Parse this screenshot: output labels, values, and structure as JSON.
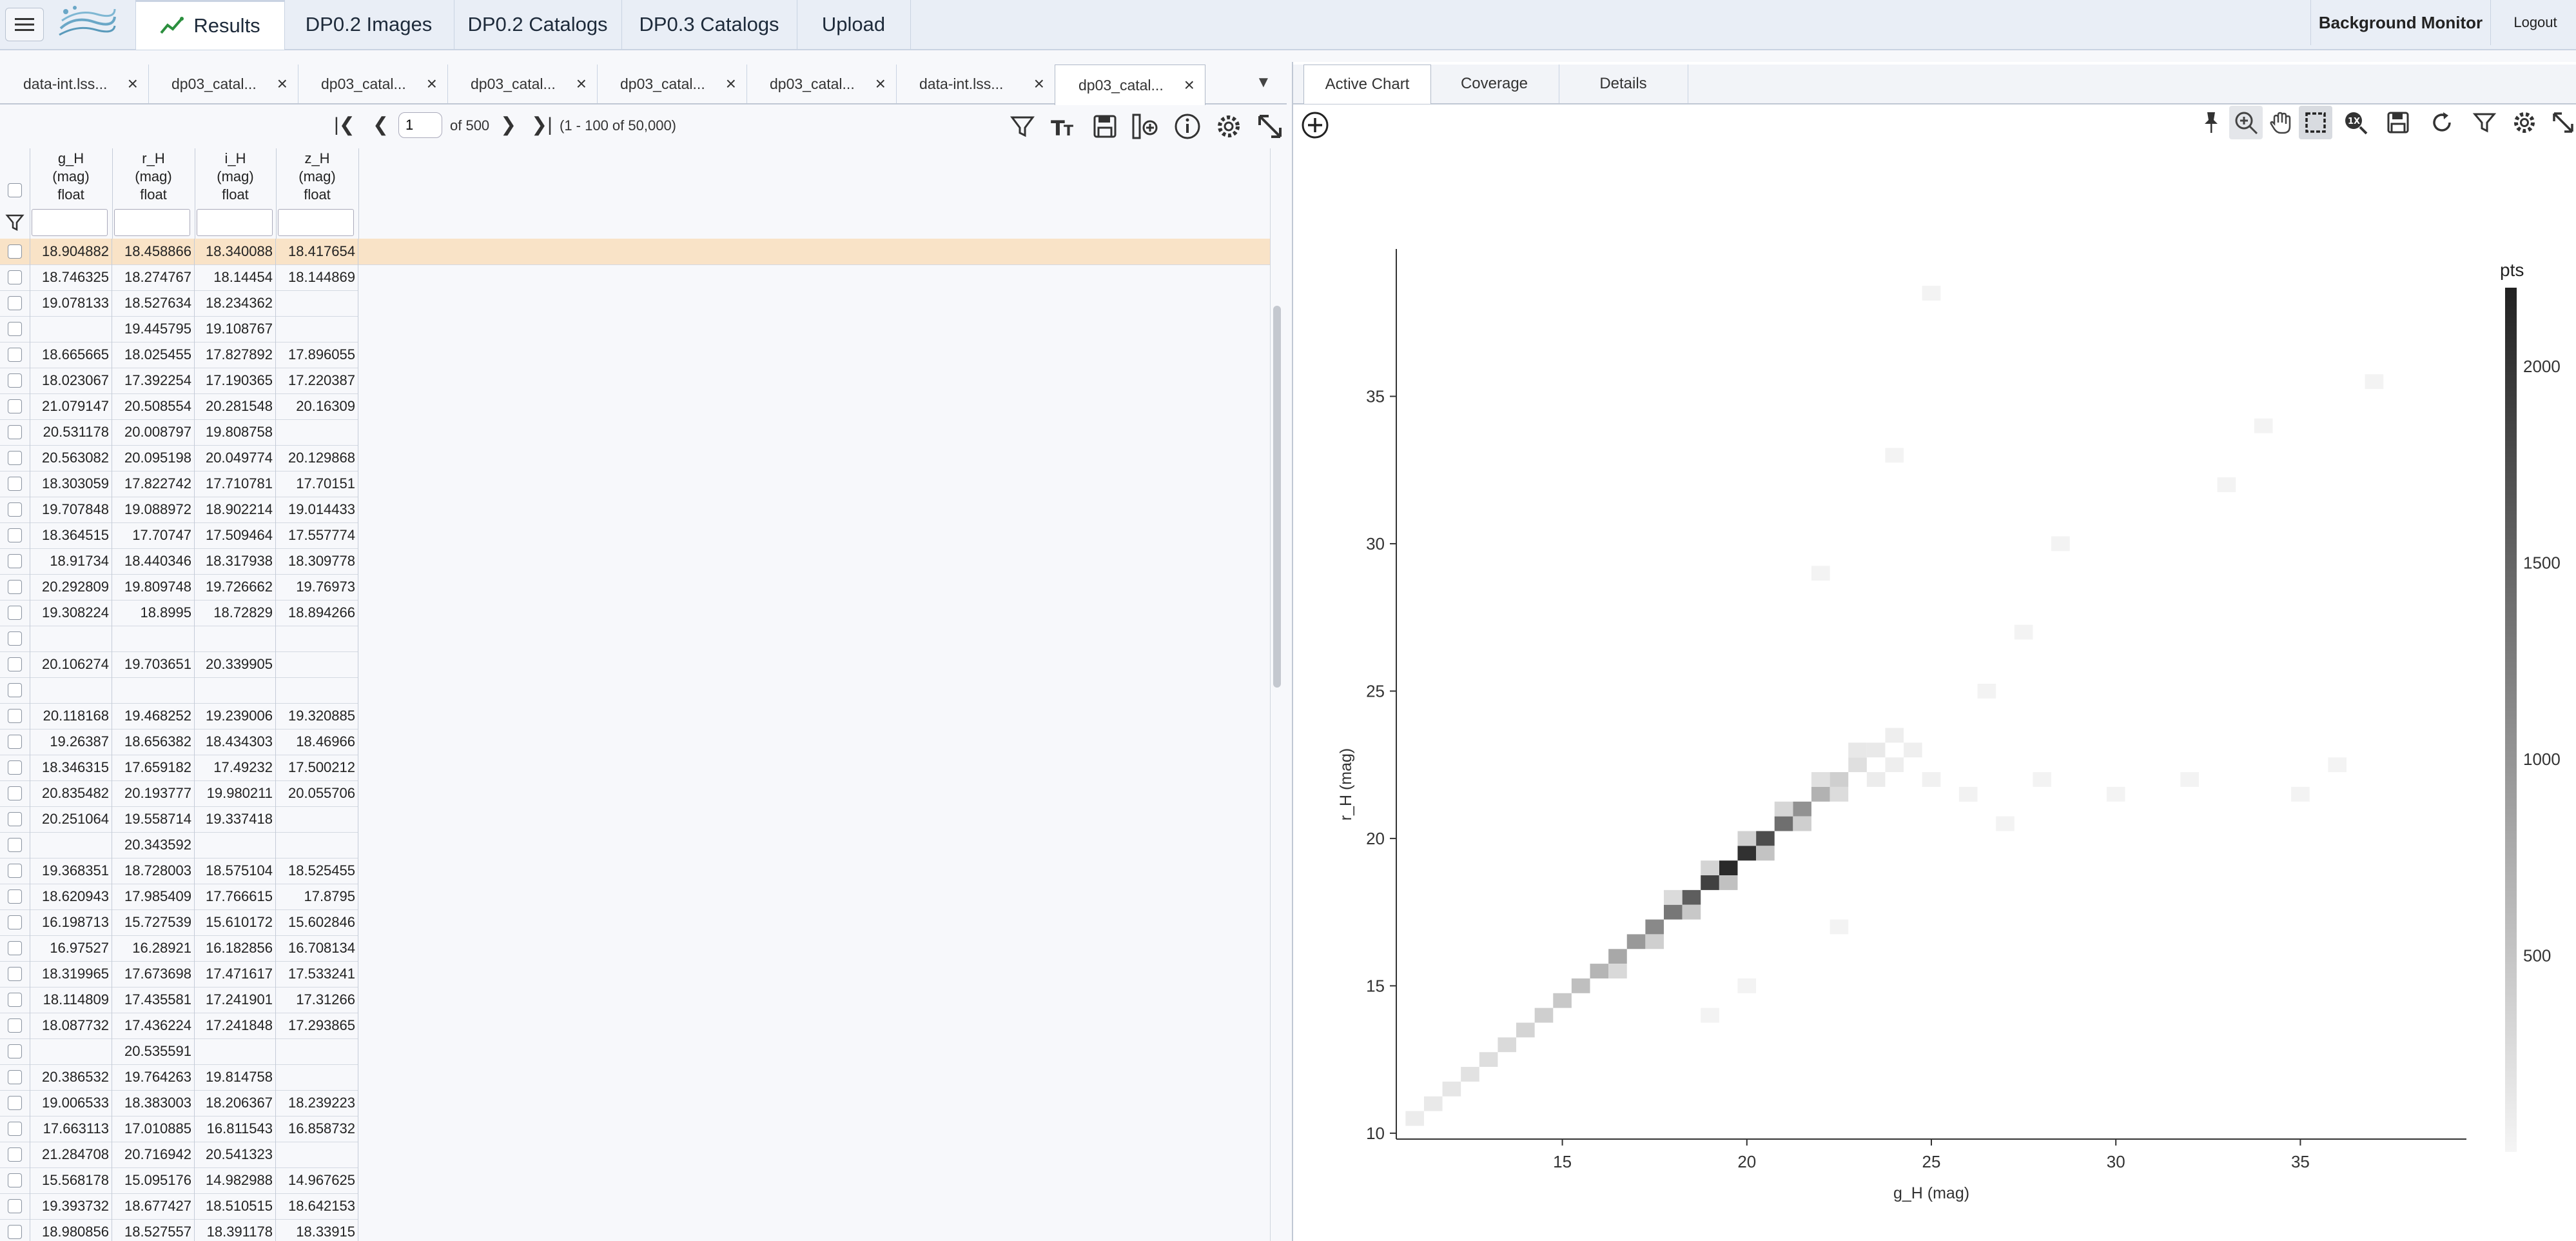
{
  "nav": {
    "tabs": [
      "Results",
      "DP0.2 Images",
      "DP0.2 Catalogs",
      "DP0.3 Catalogs",
      "Upload"
    ],
    "background_monitor": "Background Monitor",
    "logout": "Logout"
  },
  "data_tabs": [
    {
      "label": "data-int.lss..."
    },
    {
      "label": "dp03_catal..."
    },
    {
      "label": "dp03_catal..."
    },
    {
      "label": "dp03_catal..."
    },
    {
      "label": "dp03_catal..."
    },
    {
      "label": "dp03_catal..."
    },
    {
      "label": "data-int.lss..."
    },
    {
      "label": "dp03_catal...",
      "active": true
    }
  ],
  "pager": {
    "page": "1",
    "of": "of 500",
    "range": "(1 - 100 of 50,000)"
  },
  "table": {
    "columns": [
      {
        "name": "g_H",
        "unit": "(mag)",
        "type": "float"
      },
      {
        "name": "r_H",
        "unit": "(mag)",
        "type": "float"
      },
      {
        "name": "i_H",
        "unit": "(mag)",
        "type": "float"
      },
      {
        "name": "z_H",
        "unit": "(mag)",
        "type": "float"
      }
    ],
    "rows": [
      [
        "18.904882",
        "18.458866",
        "18.340088",
        "18.417654"
      ],
      [
        "18.746325",
        "18.274767",
        "18.14454",
        "18.144869"
      ],
      [
        "19.078133",
        "18.527634",
        "18.234362",
        ""
      ],
      [
        "",
        "19.445795",
        "19.108767",
        ""
      ],
      [
        "18.665665",
        "18.025455",
        "17.827892",
        "17.896055"
      ],
      [
        "18.023067",
        "17.392254",
        "17.190365",
        "17.220387"
      ],
      [
        "21.079147",
        "20.508554",
        "20.281548",
        "20.16309"
      ],
      [
        "20.531178",
        "20.008797",
        "19.808758",
        ""
      ],
      [
        "20.563082",
        "20.095198",
        "20.049774",
        "20.129868"
      ],
      [
        "18.303059",
        "17.822742",
        "17.710781",
        "17.70151"
      ],
      [
        "19.707848",
        "19.088972",
        "18.902214",
        "19.014433"
      ],
      [
        "18.364515",
        "17.70747",
        "17.509464",
        "17.557774"
      ],
      [
        "18.91734",
        "18.440346",
        "18.317938",
        "18.309778"
      ],
      [
        "20.292809",
        "19.809748",
        "19.726662",
        "19.76973"
      ],
      [
        "19.308224",
        "18.8995",
        "18.72829",
        "18.894266"
      ],
      [
        "",
        "",
        "",
        ""
      ],
      [
        "20.106274",
        "19.703651",
        "20.339905",
        ""
      ],
      [
        "",
        "",
        "",
        ""
      ],
      [
        "20.118168",
        "19.468252",
        "19.239006",
        "19.320885"
      ],
      [
        "19.26387",
        "18.656382",
        "18.434303",
        "18.46966"
      ],
      [
        "18.346315",
        "17.659182",
        "17.49232",
        "17.500212"
      ],
      [
        "20.835482",
        "20.193777",
        "19.980211",
        "20.055706"
      ],
      [
        "20.251064",
        "19.558714",
        "19.337418",
        ""
      ],
      [
        "",
        "20.343592",
        "",
        ""
      ],
      [
        "19.368351",
        "18.728003",
        "18.575104",
        "18.525455"
      ],
      [
        "18.620943",
        "17.985409",
        "17.766615",
        "17.8795"
      ],
      [
        "16.198713",
        "15.727539",
        "15.610172",
        "15.602846"
      ],
      [
        "16.97527",
        "16.28921",
        "16.182856",
        "16.708134"
      ],
      [
        "18.319965",
        "17.673698",
        "17.471617",
        "17.533241"
      ],
      [
        "18.114809",
        "17.435581",
        "17.241901",
        "17.31266"
      ],
      [
        "18.087732",
        "17.436224",
        "17.241848",
        "17.293865"
      ],
      [
        "",
        "20.535591",
        "",
        ""
      ],
      [
        "20.386532",
        "19.764263",
        "19.814758",
        ""
      ],
      [
        "19.006533",
        "18.383003",
        "18.206367",
        "18.239223"
      ],
      [
        "17.663113",
        "17.010885",
        "16.811543",
        "16.858732"
      ],
      [
        "21.284708",
        "20.716942",
        "20.541323",
        ""
      ],
      [
        "15.568178",
        "15.095176",
        "14.982988",
        "14.967625"
      ],
      [
        "19.393732",
        "18.677427",
        "18.510515",
        "18.642153"
      ],
      [
        "18.980856",
        "18.527557",
        "18.391178",
        "18.33915"
      ]
    ]
  },
  "chart_tabs": [
    "Active Chart",
    "Coverage",
    "Details"
  ],
  "chart_data": {
    "type": "heatmap",
    "xlabel": "g_H (mag)",
    "ylabel": "r_H (mag)",
    "xlim": [
      10.5,
      39.5
    ],
    "ylim": [
      9.8,
      40
    ],
    "xticks": [
      15,
      20,
      25,
      30,
      35
    ],
    "yticks": [
      10,
      15,
      20,
      25,
      30,
      35
    ],
    "colorbar": {
      "title": "pts",
      "ticks": [
        500,
        1000,
        1500,
        2000
      ],
      "max": 2200
    },
    "bins": [
      {
        "x": 11.0,
        "y": 10.5,
        "n": 40
      },
      {
        "x": 11.5,
        "y": 11.0,
        "n": 60
      },
      {
        "x": 12.0,
        "y": 11.5,
        "n": 80
      },
      {
        "x": 12.5,
        "y": 12.0,
        "n": 110
      },
      {
        "x": 13.0,
        "y": 12.5,
        "n": 140
      },
      {
        "x": 13.5,
        "y": 13.0,
        "n": 170
      },
      {
        "x": 14.0,
        "y": 13.5,
        "n": 220
      },
      {
        "x": 14.5,
        "y": 14.0,
        "n": 260
      },
      {
        "x": 15.0,
        "y": 14.5,
        "n": 320
      },
      {
        "x": 15.5,
        "y": 15.0,
        "n": 400
      },
      {
        "x": 16.0,
        "y": 15.5,
        "n": 500
      },
      {
        "x": 16.5,
        "y": 16.0,
        "n": 620
      },
      {
        "x": 17.0,
        "y": 16.5,
        "n": 780
      },
      {
        "x": 17.5,
        "y": 17.0,
        "n": 950
      },
      {
        "x": 18.0,
        "y": 17.5,
        "n": 1150
      },
      {
        "x": 18.5,
        "y": 18.0,
        "n": 1450
      },
      {
        "x": 19.0,
        "y": 18.5,
        "n": 1800
      },
      {
        "x": 19.5,
        "y": 19.0,
        "n": 2100
      },
      {
        "x": 20.0,
        "y": 19.5,
        "n": 2000
      },
      {
        "x": 20.5,
        "y": 20.0,
        "n": 1650
      },
      {
        "x": 21.0,
        "y": 20.5,
        "n": 1250
      },
      {
        "x": 21.5,
        "y": 21.0,
        "n": 850
      },
      {
        "x": 22.0,
        "y": 21.5,
        "n": 520
      },
      {
        "x": 22.5,
        "y": 22.0,
        "n": 260
      },
      {
        "x": 23.0,
        "y": 22.5,
        "n": 130
      },
      {
        "x": 23.5,
        "y": 23.0,
        "n": 60
      },
      {
        "x": 24.0,
        "y": 23.5,
        "n": 30
      },
      {
        "x": 16.5,
        "y": 15.5,
        "n": 180
      },
      {
        "x": 17.5,
        "y": 16.5,
        "n": 260
      },
      {
        "x": 18.5,
        "y": 17.5,
        "n": 320
      },
      {
        "x": 19.5,
        "y": 18.5,
        "n": 380
      },
      {
        "x": 20.5,
        "y": 19.5,
        "n": 360
      },
      {
        "x": 21.5,
        "y": 20.5,
        "n": 260
      },
      {
        "x": 22.5,
        "y": 21.5,
        "n": 150
      },
      {
        "x": 18.0,
        "y": 18.0,
        "n": 160
      },
      {
        "x": 19.0,
        "y": 19.0,
        "n": 220
      },
      {
        "x": 20.0,
        "y": 20.0,
        "n": 240
      },
      {
        "x": 21.0,
        "y": 21.0,
        "n": 200
      },
      {
        "x": 22.0,
        "y": 22.0,
        "n": 120
      },
      {
        "x": 23.0,
        "y": 23.0,
        "n": 70
      },
      {
        "x": 23.5,
        "y": 22.0,
        "n": 40
      },
      {
        "x": 24.0,
        "y": 22.5,
        "n": 30
      },
      {
        "x": 24.5,
        "y": 23.0,
        "n": 25
      },
      {
        "x": 25.0,
        "y": 22.0,
        "n": 15
      },
      {
        "x": 26.0,
        "y": 21.5,
        "n": 10
      },
      {
        "x": 27.0,
        "y": 20.5,
        "n": 8
      },
      {
        "x": 28.0,
        "y": 22.0,
        "n": 8
      },
      {
        "x": 30.0,
        "y": 21.5,
        "n": 6
      },
      {
        "x": 32.0,
        "y": 22.0,
        "n": 6
      },
      {
        "x": 35.0,
        "y": 21.5,
        "n": 6
      },
      {
        "x": 36.0,
        "y": 22.5,
        "n": 6
      },
      {
        "x": 26.5,
        "y": 25.0,
        "n": 8
      },
      {
        "x": 27.5,
        "y": 27.0,
        "n": 6
      },
      {
        "x": 28.5,
        "y": 30.0,
        "n": 6
      },
      {
        "x": 33.0,
        "y": 32.0,
        "n": 6
      },
      {
        "x": 34.0,
        "y": 34.0,
        "n": 6
      },
      {
        "x": 37.0,
        "y": 35.5,
        "n": 6
      },
      {
        "x": 22.0,
        "y": 29.0,
        "n": 6
      },
      {
        "x": 24.0,
        "y": 33.0,
        "n": 6
      },
      {
        "x": 25.0,
        "y": 38.5,
        "n": 6
      },
      {
        "x": 20.0,
        "y": 15.0,
        "n": 6
      },
      {
        "x": 19.0,
        "y": 14.0,
        "n": 6
      },
      {
        "x": 22.5,
        "y": 17.0,
        "n": 6
      }
    ]
  }
}
